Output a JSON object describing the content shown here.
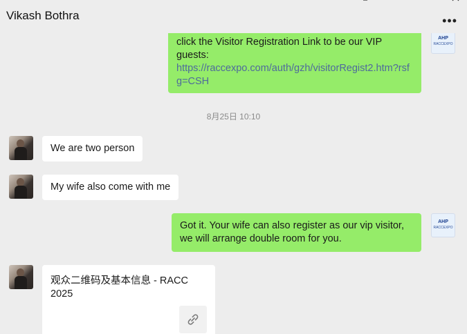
{
  "header": {
    "title": "Vikash Bothra",
    "more_label": "•••",
    "pin_icon": "pin-icon",
    "maximize_icon": "maximize-icon",
    "close_icon": "close-icon"
  },
  "messages": [
    {
      "direction": "outgoing",
      "line1": "click the Visitor Registration  Link to be our VIP",
      "line2": "guests:",
      "link": "https://raccexpo.com/auth/gzh/visitorRegist2.htm?rsfg=CSH"
    },
    {
      "direction": "timestamp",
      "text": "8月25日 10:10"
    },
    {
      "direction": "incoming",
      "text": "We are two person"
    },
    {
      "direction": "incoming",
      "text": "My wife also come with me"
    },
    {
      "direction": "outgoing",
      "text": "Got it. Your wife can also register as our vip visitor, we will arrange double room for you."
    },
    {
      "direction": "incoming",
      "card_title": "观众二维码及基本信息 - RACC 2025",
      "card_icon": "link-icon"
    }
  ],
  "avatars": {
    "self_logo_line1": "AHP",
    "self_logo_line2": "RACCEXPO"
  },
  "colors": {
    "outgoing_bubble": "#95ec69",
    "incoming_bubble": "#ffffff",
    "background": "#ededed",
    "link": "#4e6a9c"
  }
}
